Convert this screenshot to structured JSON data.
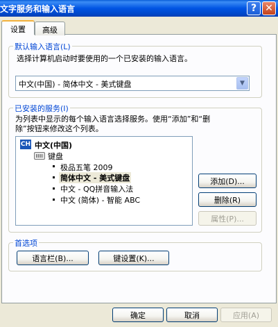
{
  "window": {
    "title": "文字服务和输入语言",
    "help_glyph": "?",
    "close_glyph": "✕"
  },
  "tabs": [
    {
      "label": "设置"
    },
    {
      "label": "高级"
    }
  ],
  "default_language": {
    "legend": "默认输入语言(L)",
    "description": "选择计算机启动时要使用的一个已安装的输入语言。",
    "selected": "中文(中国) - 简体中文 - 美式键盘"
  },
  "installed_services": {
    "legend": "已安装的服务(I)",
    "description_line1": "为列表中显示的每个输入语言选择服务。使用“添加”和“删",
    "description_line2": "除”按钮来修改这个列表。",
    "tree": {
      "language_badge": "CH",
      "language": "中文(中国)",
      "category": "键盘",
      "items": [
        "极品五笔 2009",
        "简体中文 - 美式键盘",
        "中文 - QQ拼音输入法",
        "中文 (简体) - 智能 ABC"
      ]
    },
    "buttons": {
      "add": "添加(D)...",
      "remove": "删除(R)",
      "properties": "属性(P)..."
    }
  },
  "preferences": {
    "legend": "首选项",
    "language_bar": "语言栏(B)...",
    "key_settings": "键设置(K)..."
  },
  "footer": {
    "ok": "确定",
    "cancel": "取消",
    "apply": "应用(A)"
  }
}
